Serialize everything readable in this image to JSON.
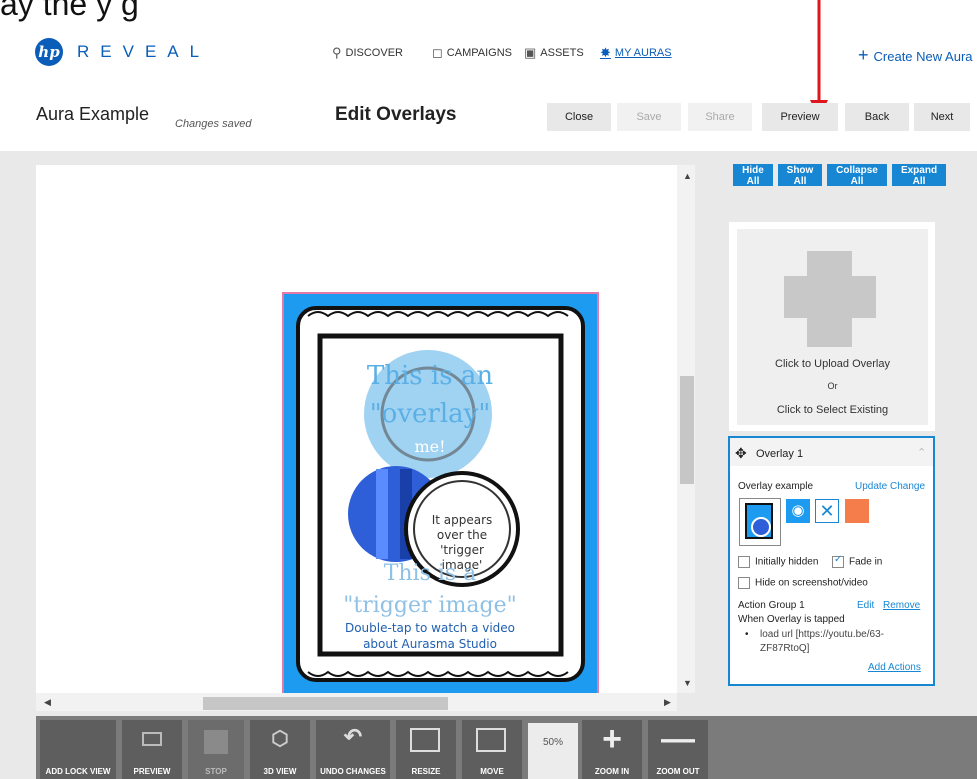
{
  "caption": {
    "text": "ay       the           y     g"
  },
  "app": {
    "logo_letters": "hp",
    "logo_word": "REVEAL"
  },
  "nav": {
    "discover": "DISCOVER",
    "campaigns": "CAMPAIGNS",
    "assets": "ASSETS",
    "my_auras": "MY AURAS",
    "create_new": "Create New Aura"
  },
  "header": {
    "aura_name": "Aura Example",
    "status": "Changes saved",
    "title": "Edit Overlays",
    "buttons": [
      "Close",
      "Save",
      "Share",
      "Preview",
      "Back",
      "Next"
    ]
  },
  "panel_buttons": [
    "Hide All",
    "Show All",
    "Collapse All",
    "Expand All"
  ],
  "trigger_image": {
    "line1": "This is an",
    "line2": "\"overlay\"",
    "line3": "me!",
    "bubble": [
      "It appears",
      "over the",
      "'trigger",
      "image'"
    ],
    "line4": "This is a",
    "line5": "\"trigger image\"",
    "line6": "Double-tap to watch a video",
    "line7": "about Aurasma Studio"
  },
  "upload": {
    "line1": "Click to Upload Overlay",
    "or": "Or",
    "line2": "Click to Select Existing"
  },
  "overlay": {
    "title": "Overlay 1",
    "name": "Overlay example",
    "update": "Update",
    "change": "Change",
    "initially_hidden": "Initially hidden",
    "fade_in": "Fade in",
    "hide_on_screenshot": "Hide on screenshot/video",
    "action_group": "Action Group 1",
    "edit": "Edit",
    "remove": "Remove",
    "when": "When Overlay is tapped",
    "action_line1": "load url [https://youtu.be/63-",
    "action_line2": "ZF87RtoQ]",
    "add_actions": "Add Actions",
    "swatch_color": "#f57c4b"
  },
  "toolbar": {
    "add_lock_view": "ADD LOCK VIEW",
    "preview": "PREVIEW",
    "stop": "STOP",
    "view3d": "3D VIEW",
    "undo": "UNDO CHANGES",
    "resize": "RESIZE",
    "move": "MOVE",
    "zoom_level": "50%",
    "zoom_in": "ZOOM IN",
    "zoom_out": "ZOOM OUT"
  },
  "colors": {
    "accent": "#1787d4",
    "brand": "#0a5db8",
    "arrow": "#e0141b"
  }
}
